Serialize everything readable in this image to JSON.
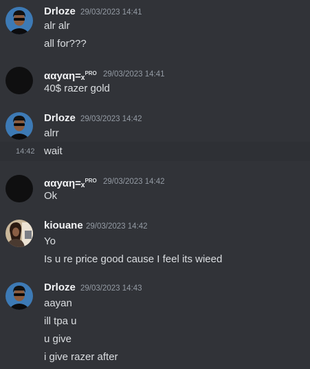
{
  "groups": [
    {
      "avatar": "dark-sunglasses-avatar",
      "username": "Drloze",
      "timestamp": "29/03/2023 14:41",
      "messages": [
        "alr alr",
        "all for???"
      ]
    },
    {
      "avatar": "blank-black-avatar",
      "username": "ααyαη",
      "username_suffix": "=ₓ",
      "username_badge": "PRO",
      "timestamp": "29/03/2023 14:41",
      "messages": [
        "40$ razer gold"
      ]
    },
    {
      "avatar": "dark-sunglasses-avatar",
      "username": "Drloze",
      "timestamp": "29/03/2023 14:42",
      "messages": [
        "alrr"
      ],
      "followup": {
        "time": "14:42",
        "text": "wait"
      }
    },
    {
      "avatar": "blank-black-avatar",
      "username": "ααyαη",
      "username_suffix": "=ₓ",
      "username_badge": "PRO",
      "timestamp": "29/03/2023 14:42",
      "messages": [
        "Ok"
      ]
    },
    {
      "avatar": "photo-avatar",
      "username": "kiouane",
      "timestamp": "29/03/2023 14:42",
      "messages": [
        "Yo",
        "Is u re price good cause I feel its wieed"
      ]
    },
    {
      "avatar": "dark-sunglasses-avatar",
      "username": "Drloze",
      "timestamp": "29/03/2023 14:43",
      "messages": [
        "aayan",
        "ill tpa u",
        "u give",
        "i give razer after"
      ]
    }
  ],
  "colors": {
    "background": "#313338",
    "hover_row": "#2e3035",
    "username": "#f2f3f5",
    "message": "#dbdee1",
    "timestamp": "#949ba4"
  }
}
